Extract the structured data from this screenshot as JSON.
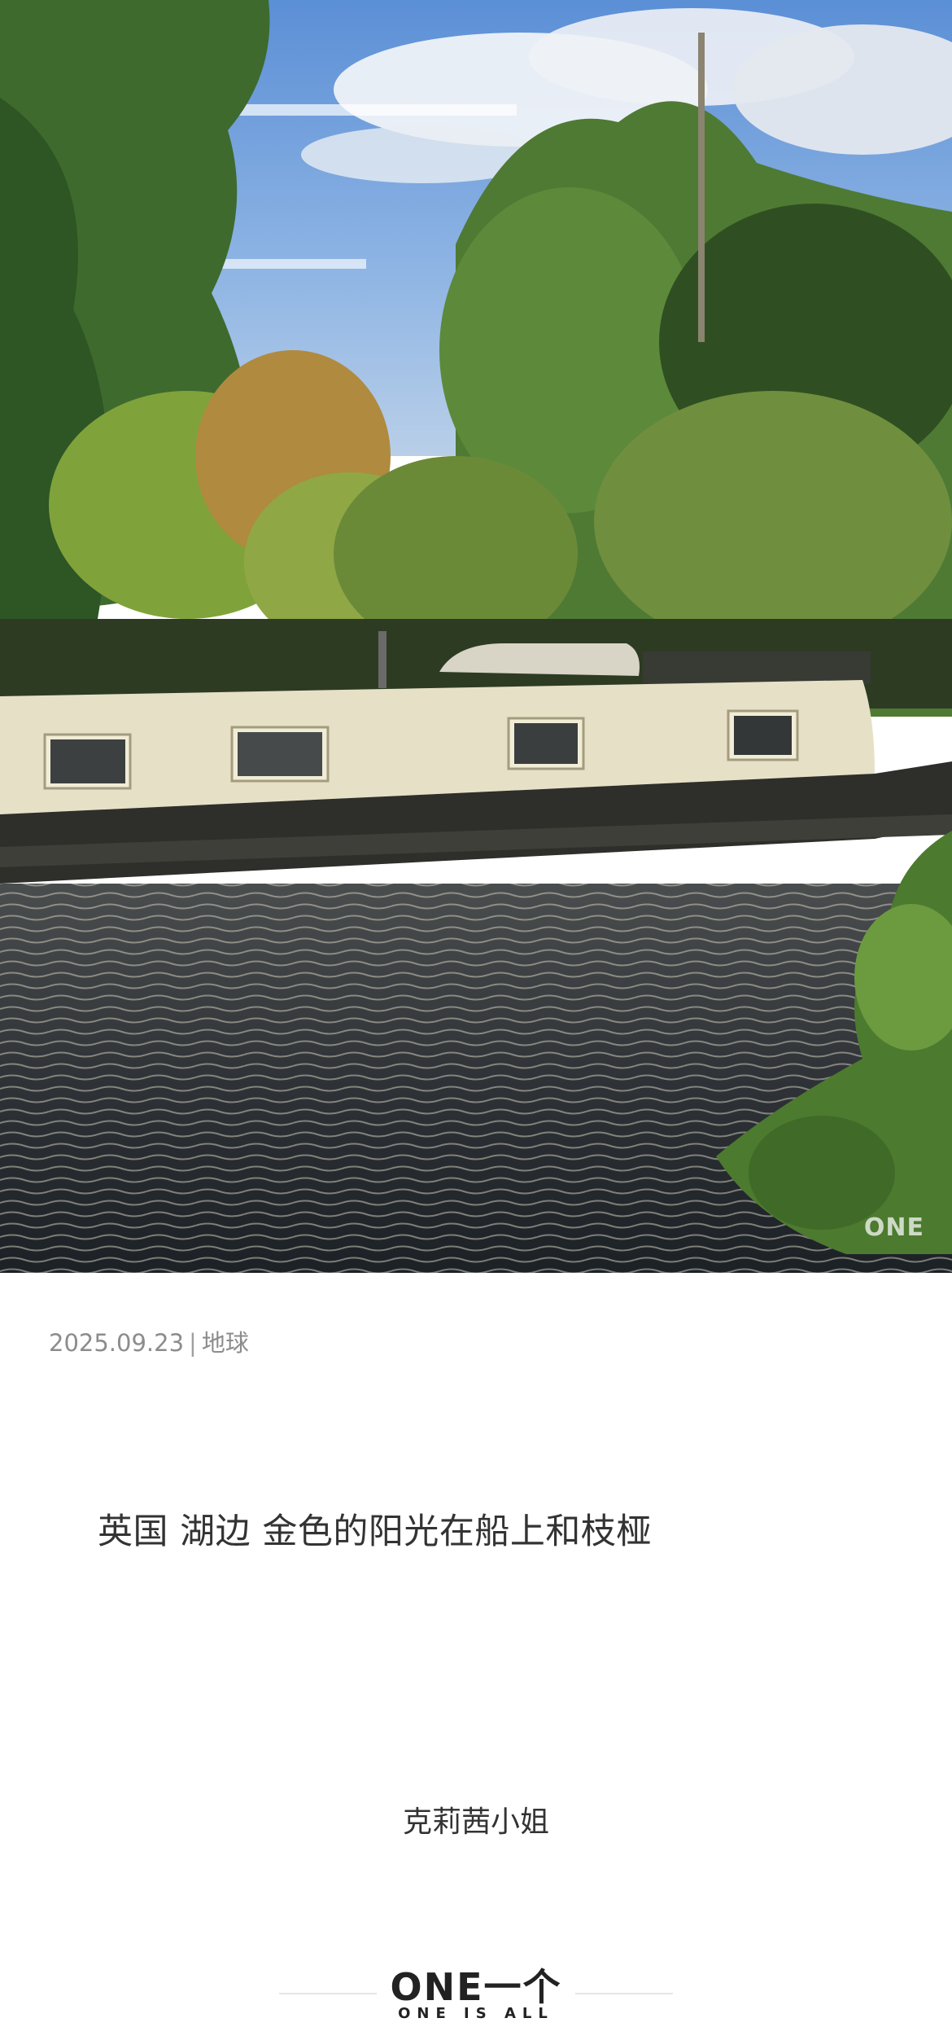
{
  "photo": {
    "watermark": "ONE"
  },
  "meta": {
    "date": "2025.09.23",
    "separator": "|",
    "location": "地球"
  },
  "caption": "英国 湖边 金色的阳光在船上和枝桠",
  "author": "克莉茜小姐",
  "footer": {
    "logo": "ONE一个",
    "tagline": "ONE IS ALL"
  }
}
